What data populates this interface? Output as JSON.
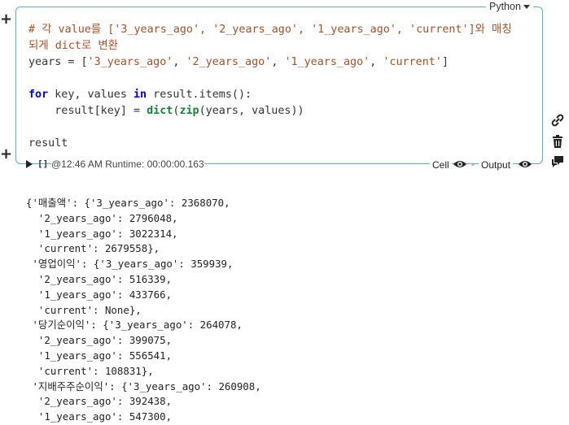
{
  "cell": {
    "language": "Python",
    "code_lines": [
      {
        "parts": [
          {
            "t": "# 각 value를 ['3_years_ago', '2_years_ago', '1_years_ago', 'current']와 매칭",
            "c": "cm"
          }
        ]
      },
      {
        "parts": [
          {
            "t": "되게 dict로 변환",
            "c": "cm"
          }
        ]
      },
      {
        "parts": [
          {
            "t": "years = [",
            "c": ""
          },
          {
            "t": "'3_years_ago'",
            "c": "st"
          },
          {
            "t": ", ",
            "c": ""
          },
          {
            "t": "'2_years_ago'",
            "c": "st"
          },
          {
            "t": ", ",
            "c": ""
          },
          {
            "t": "'1_years_ago'",
            "c": "st"
          },
          {
            "t": ", ",
            "c": ""
          },
          {
            "t": "'current'",
            "c": "st"
          },
          {
            "t": "]",
            "c": ""
          }
        ]
      },
      {
        "parts": [
          {
            "t": "",
            "c": ""
          }
        ]
      },
      {
        "parts": [
          {
            "t": "for",
            "c": "kw"
          },
          {
            "t": " key, values ",
            "c": ""
          },
          {
            "t": "in",
            "c": "kw"
          },
          {
            "t": " result.items():",
            "c": ""
          }
        ]
      },
      {
        "parts": [
          {
            "t": "    result[key] = ",
            "c": ""
          },
          {
            "t": "dict",
            "c": "fn"
          },
          {
            "t": "(",
            "c": ""
          },
          {
            "t": "zip",
            "c": "fn"
          },
          {
            "t": "(years, values))",
            "c": ""
          }
        ]
      },
      {
        "parts": [
          {
            "t": "",
            "c": ""
          }
        ]
      },
      {
        "parts": [
          {
            "t": "result",
            "c": ""
          }
        ]
      }
    ]
  },
  "status": {
    "brackets": "[]",
    "time_runtime": "@12:46 AM Runtime: 00:00:00.163",
    "cell_label": "Cell",
    "output_label": "Output",
    "separator": "-"
  },
  "icons": {
    "plus": "+",
    "side": [
      "link-icon",
      "trash-icon",
      "comment-icon"
    ]
  },
  "output_lines": [
    "{'매출액': {'3_years_ago': 2368070,",
    "  '2_years_ago': 2796048,",
    "  '1_years_ago': 3022314,",
    "  'current': 2679558},",
    " '영업이익': {'3_years_ago': 359939,",
    "  '2_years_ago': 516339,",
    "  '1_years_ago': 433766,",
    "  'current': None},",
    " '당기순이익': {'3_years_ago': 264078,",
    "  '2_years_ago': 399075,",
    "  '1_years_ago': 556541,",
    "  'current': 108831},",
    " '지배주주순이익': {'3_years_ago': 260908,",
    "  '2_years_ago': 392438,",
    "  '1_years_ago': 547300,"
  ]
}
